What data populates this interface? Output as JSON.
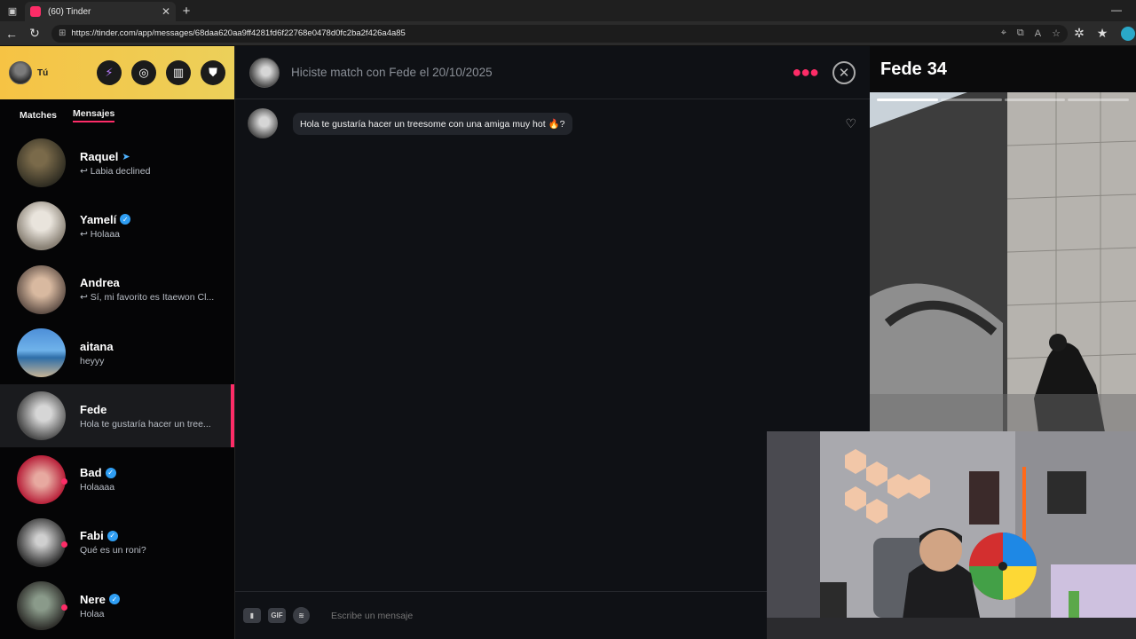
{
  "browser": {
    "tab_title": "(60) Tinder",
    "url": "https://tinder.com/app/messages/68daa620aa9ff4281fd6f22768e0478d0fc2ba2f426a4a85"
  },
  "sidebar": {
    "me_label": "Tú",
    "tabs": [
      "Matches",
      "Mensajes"
    ],
    "active_tab": "Mensajes",
    "conversations": [
      {
        "name": "Raquel",
        "preview": "Labia declined",
        "replied": true,
        "verified": false,
        "sent_icon": true
      },
      {
        "name": "Yamelí",
        "preview": "Holaaa",
        "replied": true,
        "verified": true
      },
      {
        "name": "Andrea",
        "preview": "Sí, mi favorito es Itaewon Cl...",
        "replied": true,
        "verified": false
      },
      {
        "name": "aitana",
        "preview": "heyyy",
        "replied": false,
        "verified": false
      },
      {
        "name": "Fede",
        "preview": "Hola te gustaría hacer un tree...",
        "replied": false,
        "verified": false,
        "selected": true
      },
      {
        "name": "Bad",
        "preview": "Holaaaa",
        "replied": false,
        "verified": true,
        "online": true
      },
      {
        "name": "Fabi",
        "preview": "Qué es un roni?",
        "replied": false,
        "verified": true,
        "online": true
      },
      {
        "name": "Nere",
        "preview": "Holaa",
        "replied": false,
        "verified": true,
        "online": true
      }
    ]
  },
  "chat": {
    "match_text": "Hiciste match con Fede el 20/10/2025",
    "messages": [
      {
        "text": "Hola te gustaría hacer un treesome con una amiga muy hot 🔥?"
      }
    ],
    "composer_placeholder": "Escribe un mensaje",
    "composer_buttons": [
      "sticker",
      "GIF",
      "spotify"
    ]
  },
  "profile": {
    "name": "Fede",
    "age": "34",
    "photo_count": 4,
    "photo_index": 1
  },
  "colors": {
    "brand": "#fd2c67",
    "header_yellow": "#f6c344",
    "verified": "#2f9ef3"
  }
}
